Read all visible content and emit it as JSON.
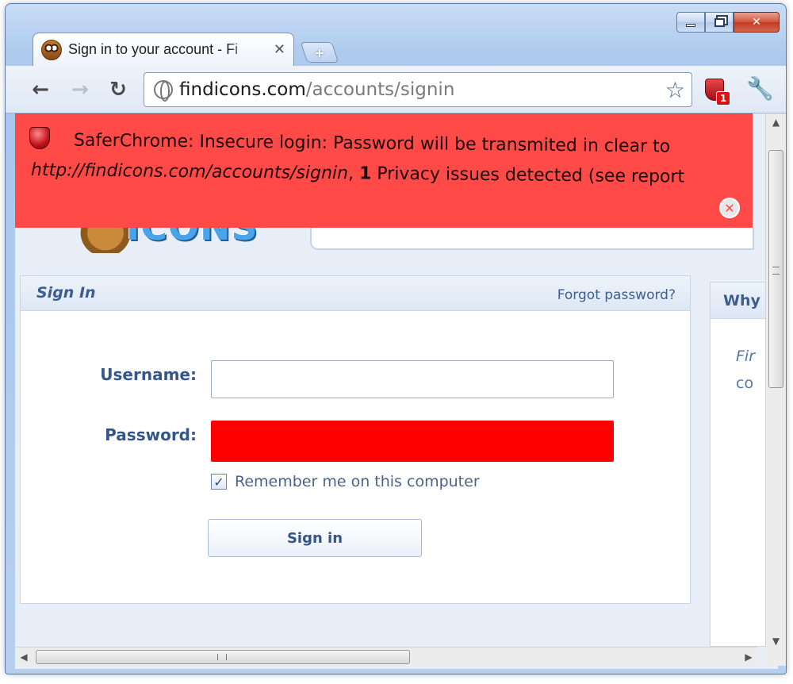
{
  "browser": {
    "tab": {
      "title": "Sign in to your account - Fi",
      "favicon": "owl-favicon-icon",
      "close_glyph": "✕"
    },
    "new_tab_glyph": "+",
    "caption": {
      "min_glyph": "",
      "max_glyph": "",
      "close_glyph": "✕"
    },
    "nav": {
      "back": "←",
      "forward": "→",
      "reload": "↻"
    },
    "omnibox": {
      "host": "findicons.com",
      "path": "/accounts/signin"
    },
    "bookmark_star": "☆",
    "extension": {
      "icon": "shield-icon",
      "badge": "1"
    },
    "wrench": "🔧"
  },
  "infobar": {
    "prefix": "SaferChrome: Insecure login: Password will be transmited in clear to",
    "url": "http://findicons.com/accounts/signin",
    "separator": ",",
    "count": "1",
    "suffix": "Privacy issues detected (see report",
    "close_glyph": "✕",
    "color": "#ff4a47"
  },
  "site": {
    "logo_text": "ICONS"
  },
  "signin_panel": {
    "title": "Sign In",
    "forgot_link": "Forgot password?",
    "username_label": "Username:",
    "username_value": "",
    "password_label": "Password:",
    "remember_label": "Remember me on this computer",
    "remember_checked": "✓",
    "submit_label": "Sign in"
  },
  "side_panel": {
    "title": "Why",
    "line1": "Fir",
    "line2": "co"
  },
  "scrollbars": {
    "vertical_grip": "≡",
    "up": "▲",
    "down": "▼",
    "left": "◀",
    "right": "▶"
  }
}
